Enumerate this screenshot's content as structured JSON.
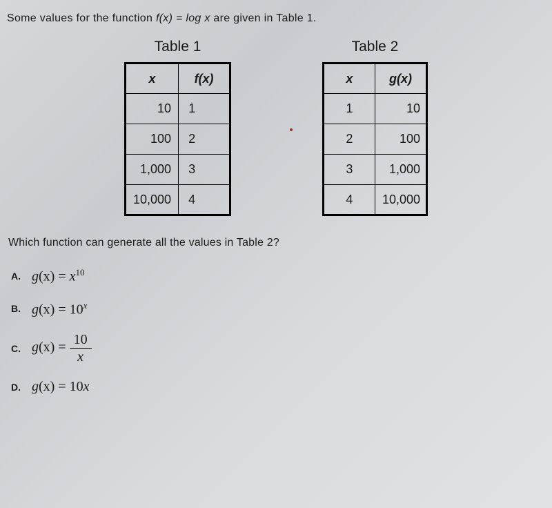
{
  "intro_prefix": "Some values for the function ",
  "intro_fx": "f(x) = log x",
  "intro_suffix": " are given in Table 1.",
  "table1": {
    "title": "Table 1",
    "header_x": "x",
    "header_f": "f(x)",
    "rows": [
      {
        "x": "10",
        "f": "1"
      },
      {
        "x": "100",
        "f": "2"
      },
      {
        "x": "1,000",
        "f": "3"
      },
      {
        "x": "10,000",
        "f": "4"
      }
    ]
  },
  "table2": {
    "title": "Table 2",
    "header_x": "x",
    "header_g": "g(x)",
    "rows": [
      {
        "x": "1",
        "g": "10"
      },
      {
        "x": "2",
        "g": "100"
      },
      {
        "x": "3",
        "g": "1,000"
      },
      {
        "x": "4",
        "g": "10,000"
      }
    ]
  },
  "question": "Which function can generate all the values in Table 2?",
  "options": {
    "a": {
      "label": "A.",
      "g": "g",
      "paren": "(x) = ",
      "base": "x",
      "exp": "10"
    },
    "b": {
      "label": "B.",
      "g": "g",
      "paren": "(x) = ",
      "base": "10",
      "exp": "x"
    },
    "c": {
      "label": "C.",
      "g": "g",
      "paren": "(x) = ",
      "num": "10",
      "den": "x"
    },
    "d": {
      "label": "D.",
      "g": "g",
      "paren": "(x) = ",
      "val": "10",
      "var": "x"
    }
  },
  "chart_data": [
    {
      "type": "table",
      "title": "Table 1",
      "columns": [
        "x",
        "f(x)"
      ],
      "rows": [
        [
          10,
          1
        ],
        [
          100,
          2
        ],
        [
          1000,
          3
        ],
        [
          10000,
          4
        ]
      ]
    },
    {
      "type": "table",
      "title": "Table 2",
      "columns": [
        "x",
        "g(x)"
      ],
      "rows": [
        [
          1,
          10
        ],
        [
          2,
          100
        ],
        [
          3,
          1000
        ],
        [
          4,
          10000
        ]
      ]
    }
  ]
}
